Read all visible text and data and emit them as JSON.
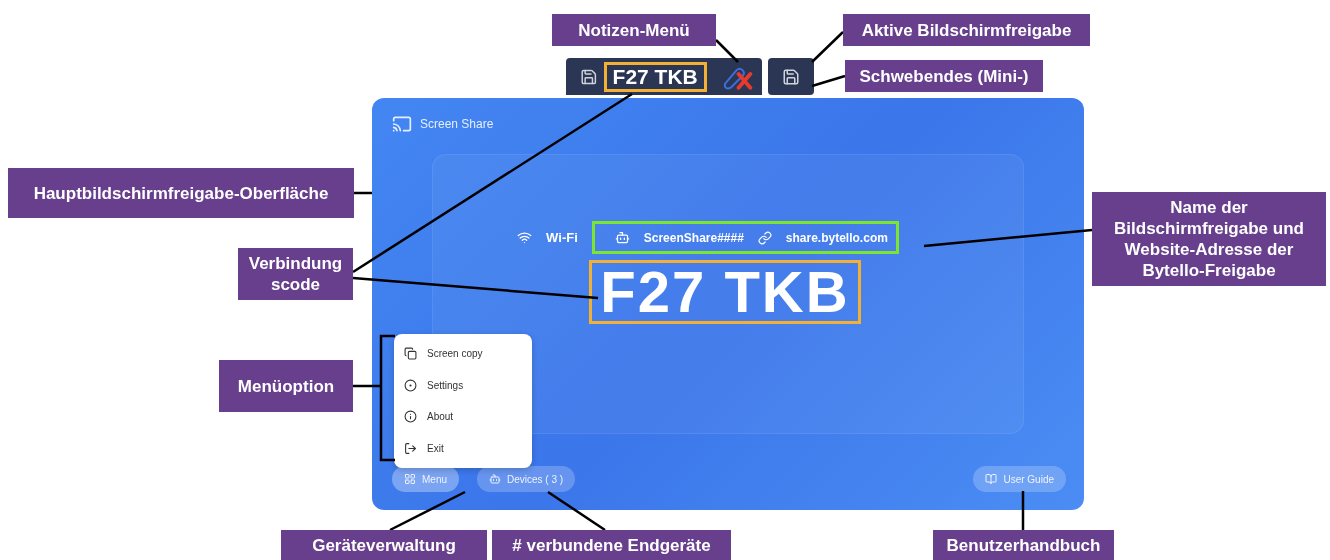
{
  "callouts": [
    {
      "text": "Notizen-Menü"
    },
    {
      "text": "Aktive Bildschirmfreigabe"
    },
    {
      "text": "Schwebendes (Mini-)"
    },
    {
      "text": "Hauptbildschirmfreigabe-Oberfläche"
    },
    {
      "text": "Verbindung scode"
    },
    {
      "text": "Name der Bildschirmfreigabe und Website-Adresse der Bytello-Freigabe"
    },
    {
      "text": "Menüoption"
    },
    {
      "text": "Geräteverwaltung"
    },
    {
      "text": "# verbundene Endgeräte"
    },
    {
      "text": "Benutzerhandbuch"
    }
  ],
  "toolbar": {
    "code": "F27 TKB"
  },
  "panel": {
    "title": "Screen Share",
    "network": "Wi-Fi",
    "share_name": "ScreenShare####",
    "website": "share.bytello.com",
    "code": "F27 TKB",
    "menu_items": [
      "Screen copy",
      "Settings",
      "About",
      "Exit"
    ],
    "buttons": [
      {
        "label": "Menu",
        "expanded": true
      },
      {
        "label": "Devices ( 3 )",
        "expanded": false
      }
    ],
    "user_guide": "User Guide"
  }
}
